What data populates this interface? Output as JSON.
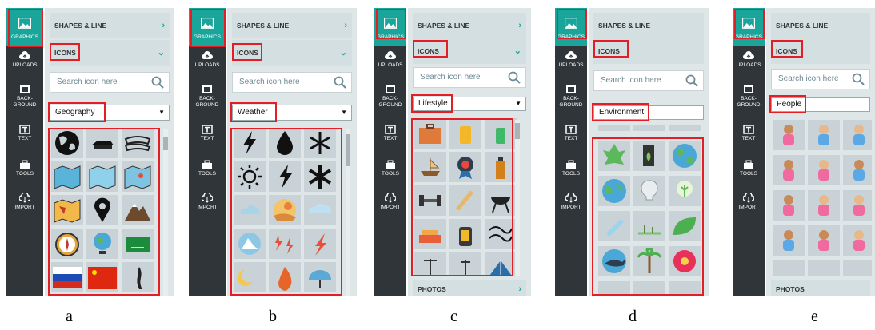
{
  "sidebar": {
    "graphics_label": "GRAPHICS",
    "uploads_label": "UPLOADS",
    "background_label_1": "BACK-",
    "background_label_2": "GROUND",
    "text_label": "TEXT",
    "tools_label": "TOOLS",
    "import_label": "IMPORT"
  },
  "sections": {
    "shapes_line": "SHAPES & LINE",
    "icons": "ICONS",
    "photos": "PHOTOS"
  },
  "search": {
    "placeholder": "Search icon here"
  },
  "panels": [
    {
      "caption": "a",
      "category": "Geography"
    },
    {
      "caption": "b",
      "category": "Weather"
    },
    {
      "caption": "c",
      "category": "Lifestyle"
    },
    {
      "caption": "d",
      "category": "Environment"
    },
    {
      "caption": "e",
      "category": "People"
    }
  ],
  "colors": {
    "accent": "#1aa59b",
    "highlight": "#e31e25",
    "rail": "#2f3538",
    "panel": "#dfe6e8"
  }
}
